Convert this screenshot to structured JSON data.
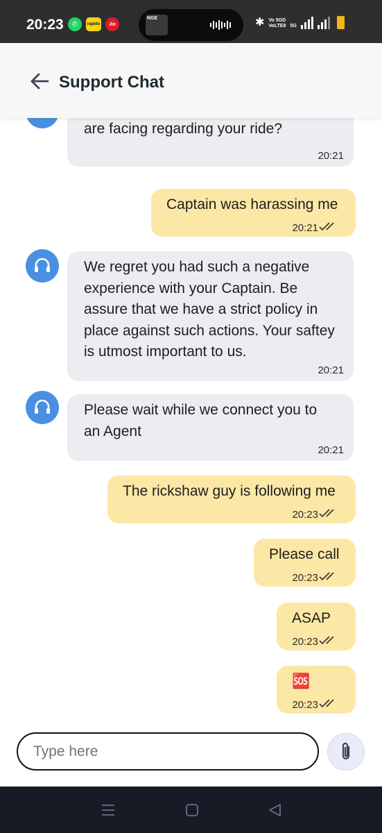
{
  "status_bar": {
    "time": "20:23",
    "apps": [
      {
        "name": "whatsapp",
        "label": "✆"
      },
      {
        "name": "rapido",
        "label": "rapido"
      },
      {
        "name": "jio",
        "label": "Jio"
      }
    ],
    "island_art_label": "NGE",
    "network_label_1": "Vo 5GD",
    "network_label_2": "VoLTE8",
    "network_type": "5G"
  },
  "header": {
    "title": "Support Chat"
  },
  "messages": [
    {
      "side": "in",
      "text": "Can you please specify the issue you are facing regarding your ride?",
      "time": "20:21"
    },
    {
      "side": "out",
      "text": "Captain was harassing me",
      "time": "20:21"
    },
    {
      "side": "in",
      "text": "We regret you had such a negative experience with your Captain. Be assure that we have a strict policy in place against such actions. Your saftey is utmost important to us.",
      "time": "20:21"
    },
    {
      "side": "in",
      "text": "Please wait while we connect you to an Agent",
      "time": "20:21"
    },
    {
      "side": "out",
      "text": "The rickshaw guy is following me",
      "time": "20:23"
    },
    {
      "side": "out",
      "text": "Please call",
      "time": "20:23"
    },
    {
      "side": "out",
      "text": "ASAP",
      "time": "20:23"
    },
    {
      "side": "out",
      "text": "🆘",
      "time": "20:23"
    }
  ],
  "composer": {
    "placeholder": "Type here",
    "value": ""
  },
  "colors": {
    "incoming_bubble": "#ecedf1",
    "outgoing_bubble": "#fbe8a6",
    "avatar": "#4a90e2",
    "status_bar": "#2e2e30",
    "nav_bar": "#171b26"
  },
  "icons": {
    "back": "arrow-left-icon",
    "agent_avatar": "headset-icon",
    "read_receipt": "double-check-icon",
    "attach": "paperclip-icon",
    "nav_menu": "menu-icon",
    "nav_home": "square-home-icon",
    "nav_back": "triangle-back-icon"
  }
}
